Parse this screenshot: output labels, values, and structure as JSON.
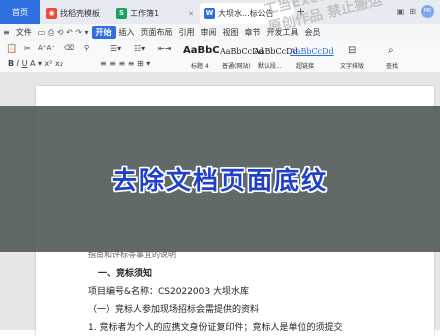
{
  "tabs": {
    "home": "首页",
    "tab1": "找稻壳模板",
    "tab2": "工作簿1",
    "tab3": "大坝水...标公告",
    "add": "+"
  },
  "window": {
    "avatar_text": "MK"
  },
  "menubar": {
    "file_icon": "≡",
    "file": "文件",
    "start": "开始",
    "items": [
      "插入",
      "页面布局",
      "引用",
      "审阅",
      "视图",
      "章节",
      "开发工具",
      "会员"
    ]
  },
  "ribbon": {
    "styles": [
      {
        "sample": "AaBbC",
        "label": "标题 4"
      },
      {
        "sample": "AaBbCcDd",
        "label": "普通(网站)"
      },
      {
        "sample": "AaBbCcDd",
        "label": "默认段..."
      },
      {
        "sample": "AaBbCcDd",
        "label": "超链接"
      }
    ],
    "text_tools": "文字排版",
    "find_replace": "查找"
  },
  "overlay": {
    "title": "去除文档页面底纹"
  },
  "document": {
    "line0": "指南和评标等事宜的说明",
    "heading": "一、竞标须知",
    "project": "项目编号&名称：CS2022003 大坝水库",
    "sub1": "（一）竞标人参加现场招标会需提供的资料",
    "item1": "1. 竞标者为个人的应携文身份证复印件；竞标人是单位的须提交"
  },
  "watermark": {
    "line1": "工当Excel零基础",
    "line2": "原创作品 禁止搬运"
  },
  "colors": {
    "accent": "#2f6fe0",
    "overlay_bg": "#545c5c",
    "overlay_text": "#2040c8"
  }
}
